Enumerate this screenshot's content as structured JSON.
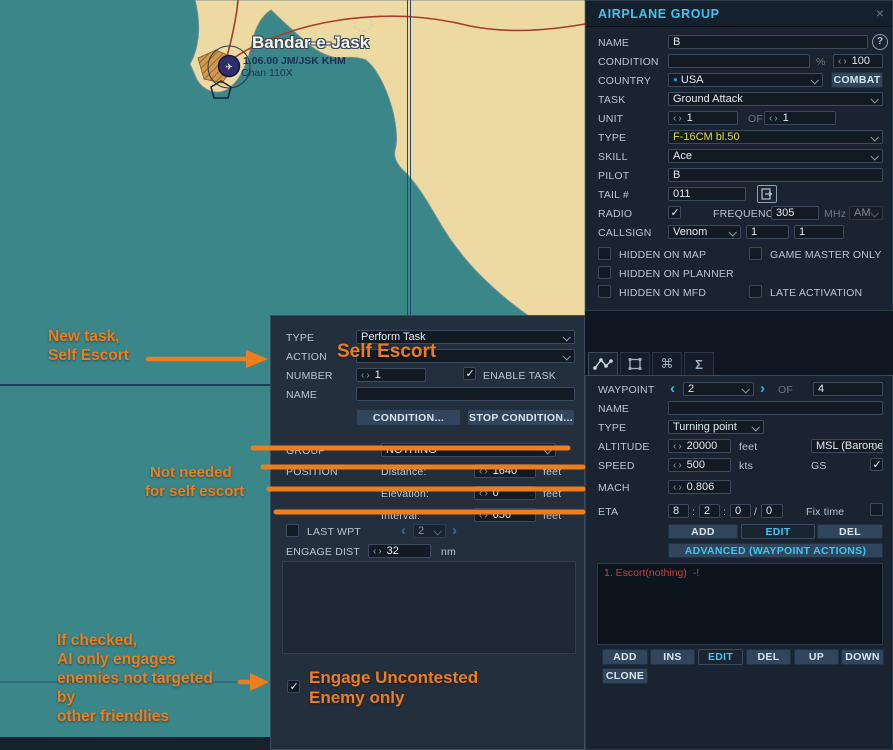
{
  "icons": {
    "close": "×",
    "help": "?",
    "country_dot": "●",
    "tab_command": "⌘",
    "tab_sigma": "Σ",
    "eta_colon": ":",
    "eta_slash": "/"
  },
  "map": {
    "place_label": "Bandar-e-Jask",
    "airport_info": "1.06.00 JM/JSK KHM",
    "tacan_label": "Chan 110X"
  },
  "annotations": {
    "new_task_line1": "New task,",
    "new_task_line2": "Self Escort",
    "action_overlay": "Self Escort",
    "not_needed_line1": "Not needed",
    "not_needed_line2": "for self escort",
    "if_checked_line1": "If checked,",
    "if_checked_line2": "AI only engages",
    "if_checked_line3": "enemies not targeted",
    "if_checked_line4": "by",
    "if_checked_line5": "other friendlies",
    "engage_line1": "Engage Uncontested",
    "engage_line2": "Enemy only",
    "accent_orange": "#ee7d1e"
  },
  "airplane_group": {
    "title": "AIRPLANE GROUP",
    "name_label": "NAME",
    "name_value": "B",
    "condition_label": "CONDITION",
    "condition_value": "",
    "percent": "%",
    "condition_spin": "100",
    "country_label": "COUNTRY",
    "country_value": "USA",
    "combat_button": "COMBAT",
    "task_label": "TASK",
    "task_value": "Ground Attack",
    "unit_label": "UNIT",
    "unit_value": "1",
    "of_label": "OF",
    "unit_total": "1",
    "type_label": "TYPE",
    "type_value": "F-16CM bl.50",
    "type_color": "#dcdc46",
    "skill_label": "SKILL",
    "skill_value": "Ace",
    "pilot_label": "PILOT",
    "pilot_value": "B",
    "tail_label": "TAIL #",
    "tail_value": "011",
    "radio_label": "RADIO",
    "frequency_label": "FREQUENCY",
    "frequency_value": "305",
    "mhz_label": "MHz",
    "am_value": "AM",
    "callsign_label": "CALLSIGN",
    "callsign_value": "Venom",
    "callsign_num1": "1",
    "callsign_num2": "1",
    "chk_hidden_map": "HIDDEN ON MAP",
    "chk_game_master": "GAME MASTER ONLY",
    "chk_hidden_planner": "HIDDEN ON PLANNER",
    "chk_hidden_mfd": "HIDDEN ON MFD",
    "chk_late_activation": "LATE ACTIVATION"
  },
  "waypoint_panel": {
    "waypoint_label": "WAYPOINT",
    "waypoint_value": "2",
    "of_label": "OF",
    "waypoint_total": "4",
    "name_label": "NAME",
    "name_value": "",
    "type_label": "TYPE",
    "type_value": "Turning point",
    "altitude_label": "ALTITUDE",
    "altitude_value": "20000",
    "feet_label": "feet",
    "alt_ref_value": "MSL (Barome",
    "speed_label": "SPEED",
    "speed_value": "500",
    "kts_label": "kts",
    "gs_label": "GS",
    "mach_label": "MACH",
    "mach_value": "0.806",
    "eta_label": "ETA",
    "eta_h": "8",
    "eta_m": "2",
    "eta_s": "0",
    "eta_d": "0",
    "fix_time_label": "Fix time",
    "add_button": "ADD",
    "edit_button": "EDIT",
    "del_button": "DEL",
    "advanced_button": "ADVANCED (WAYPOINT ACTIONS)",
    "action_item": "1. Escort(nothing)  -!",
    "list_add": "ADD",
    "list_ins": "INS",
    "list_edit": "EDIT",
    "list_del": "DEL",
    "list_up": "UP",
    "list_down": "DOWN",
    "list_clone": "CLONE"
  },
  "task_dialog": {
    "type_label": "TYPE",
    "type_value": "Perform Task",
    "action_label": "ACTION",
    "number_label": "NUMBER",
    "number_value": "1",
    "enable_task_label": "ENABLE TASK",
    "name_label": "NAME",
    "name_value": "",
    "condition_button": "CONDITION...",
    "stop_condition_button": "STOP CONDITION...",
    "group_label": "GROUP",
    "group_value": "NOTHING",
    "position_label": "POSITION",
    "distance_label": "Distance:",
    "distance_value": "1640",
    "elevation_label": "Elevation:",
    "elevation_value": "0",
    "interval_label": "Interval:",
    "interval_value": "656",
    "feet_label": "feet",
    "last_wpt_label": "LAST WPT",
    "last_wpt_value": "2",
    "engage_dist_label": "ENGAGE DIST",
    "engage_dist_value": "32",
    "nm_label": "nm"
  }
}
